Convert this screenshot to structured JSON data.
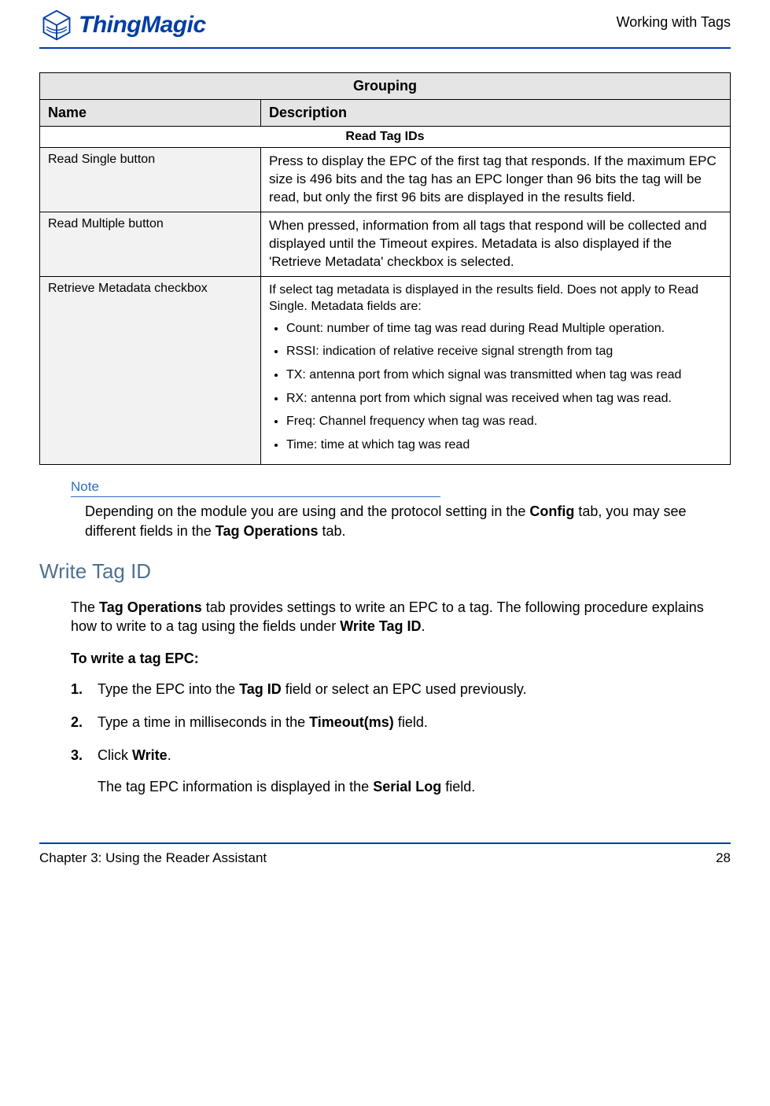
{
  "header": {
    "brand": "ThingMagic",
    "section_label": "Working with Tags"
  },
  "table": {
    "title": "Grouping",
    "col_name": "Name",
    "col_desc": "Description",
    "section_title": "Read Tag IDs",
    "rows": [
      {
        "name": "Read Single button",
        "desc": "Press to display the EPC of the first tag that responds. If the maximum EPC size is 496 bits and the tag has an EPC longer than 96 bits the tag will be read, but only the first 96 bits are displayed in the results field."
      },
      {
        "name": "Read Multiple button",
        "desc": "When pressed, information from all tags that respond will be collected and displayed until the Timeout expires. Metadata is also displayed if the 'Retrieve Metadata' checkbox is selected."
      },
      {
        "name": "Retrieve Metadata checkbox",
        "meta_intro": "If select tag metadata is displayed in the results field. Does not apply to Read Single. Metadata fields are:",
        "meta_items": [
          "Count: number of time tag was read during Read Multiple operation.",
          "RSSI: indication of relative receive signal strength from tag",
          "TX: antenna port from which signal was transmitted when tag was read",
          "RX: antenna port from which signal was received when tag was read.",
          "Freq: Channel frequency when tag was read.",
          "Time: time at which tag was read"
        ]
      }
    ]
  },
  "note": {
    "label": "Note",
    "text_pre": "Depending on the module you are using and the protocol setting in the ",
    "bold1": "Config",
    "text_mid": " tab, you may see different fields in the ",
    "bold2": "Tag Operations",
    "text_post": " tab."
  },
  "write_section": {
    "heading": "Write Tag ID",
    "intro_pre": "The ",
    "intro_b1": "Tag Operations",
    "intro_mid": " tab provides settings to write an EPC to a tag. The following procedure explains how to write to a tag using the fields under ",
    "intro_b2": "Write Tag ID",
    "intro_post": ".",
    "procedure_title": "To write a tag EPC:",
    "steps": [
      {
        "pre": "Type the EPC into the ",
        "b": "Tag ID",
        "post": " field or select an EPC used previously."
      },
      {
        "pre": "Type a time in milliseconds in the ",
        "b": "Timeout(ms)",
        "post": " field."
      },
      {
        "pre": "Click ",
        "b": "Write",
        "post": "."
      }
    ],
    "result_pre": "The tag EPC information is displayed in the ",
    "result_b": "Serial Log",
    "result_post": " field."
  },
  "footer": {
    "chapter": "Chapter 3: Using the Reader Assistant",
    "page_number": "28"
  }
}
